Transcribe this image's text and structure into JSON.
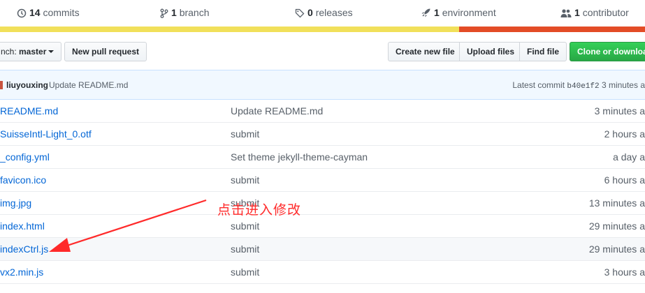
{
  "summary": {
    "commits": {
      "count": "14",
      "label": "commits"
    },
    "branches": {
      "count": "1",
      "label": "branch"
    },
    "releases": {
      "count": "0",
      "label": "releases"
    },
    "environments": {
      "count": "1",
      "label": "environment"
    },
    "contributors": {
      "count": "1",
      "label": "contributor"
    }
  },
  "language_bar": [
    {
      "color": "#f1e05a",
      "fraction": 0.712
    },
    {
      "color": "#e34c26",
      "fraction": 0.288
    }
  ],
  "toolbar": {
    "branch_label": "nch: ",
    "branch_value": "master",
    "new_pull_request": "New pull request",
    "create_new_file": "Create new file",
    "upload_files": "Upload files",
    "find_file": "Find file",
    "clone_or_download": "Clone or download"
  },
  "commit_tease": {
    "author": "liuyouxing",
    "message": "Update README.md",
    "latest_commit_label": "Latest commit",
    "sha": "b40e1f2",
    "age": "3 minutes a"
  },
  "files": [
    {
      "name": "README.md",
      "message": "Update README.md",
      "age": "3 minutes a"
    },
    {
      "name": "SuisseIntl-Light_0.otf",
      "message": "submit",
      "age": "2 hours a"
    },
    {
      "name": "_config.yml",
      "message": "Set theme jekyll-theme-cayman",
      "age": "a day a"
    },
    {
      "name": "favicon.ico",
      "message": "submit",
      "age": "6 hours a"
    },
    {
      "name": "img.jpg",
      "message": "submit",
      "age": "13 minutes a"
    },
    {
      "name": "index.html",
      "message": "submit",
      "age": "29 minutes a"
    },
    {
      "name": "indexCtrl.js",
      "message": "submit",
      "age": "29 minutes a"
    },
    {
      "name": "vx2.min.js",
      "message": "submit",
      "age": "3 hours a"
    }
  ],
  "annotation": {
    "text": "点击进入修改",
    "color": "#ff2a2a"
  }
}
